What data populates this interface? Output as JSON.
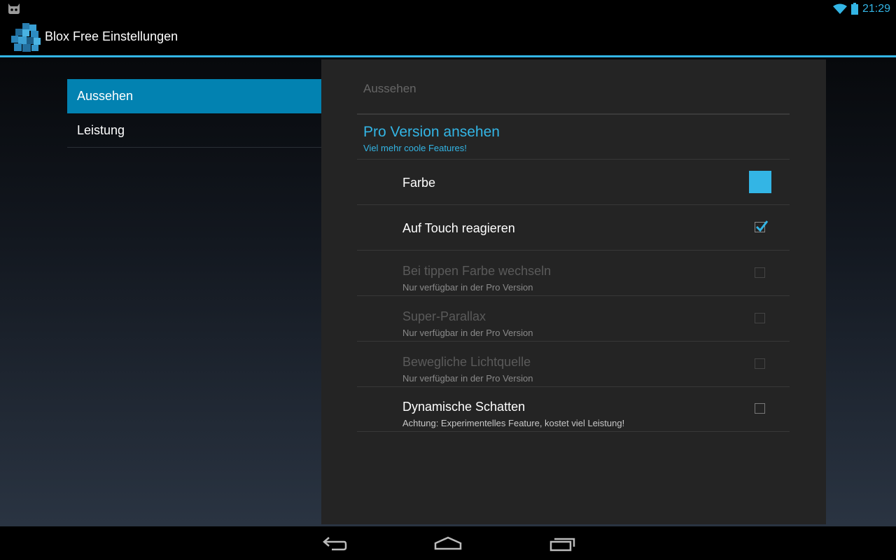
{
  "statusbar": {
    "time": "21:29"
  },
  "actionbar": {
    "title": "Blox Free Einstellungen"
  },
  "headers": [
    {
      "label": "Aussehen",
      "selected": true
    },
    {
      "label": "Leistung",
      "selected": false
    }
  ],
  "panel": {
    "category": "Aussehen",
    "pro": {
      "title": "Pro Version ansehen",
      "summary": "Viel mehr coole Features!"
    },
    "prefs": [
      {
        "title": "Farbe",
        "summary": "",
        "widget": "color",
        "color": "#33b5e5",
        "enabled": true
      },
      {
        "title": "Auf Touch reagieren",
        "summary": "",
        "widget": "checkbox",
        "checked": true,
        "enabled": true
      },
      {
        "title": "Bei tippen Farbe wechseln",
        "summary": "Nur verfügbar in der Pro Version",
        "widget": "checkbox",
        "checked": false,
        "enabled": false
      },
      {
        "title": "Super-Parallax",
        "summary": "Nur verfügbar in der Pro Version",
        "widget": "checkbox",
        "checked": false,
        "enabled": false
      },
      {
        "title": "Bewegliche Lichtquelle",
        "summary": "Nur verfügbar in der Pro Version",
        "widget": "checkbox",
        "checked": false,
        "enabled": false
      },
      {
        "title": "Dynamische Schatten",
        "summary": "Achtung: Experimentelles Feature, kostet viel Leistung!",
        "widget": "checkbox",
        "checked": false,
        "enabled": true
      }
    ]
  },
  "navbar": {
    "buttons": [
      "back-icon",
      "home-icon",
      "recents-icon"
    ]
  },
  "colors": {
    "accent": "#33b5e5",
    "selected_header": "#0282b1"
  }
}
